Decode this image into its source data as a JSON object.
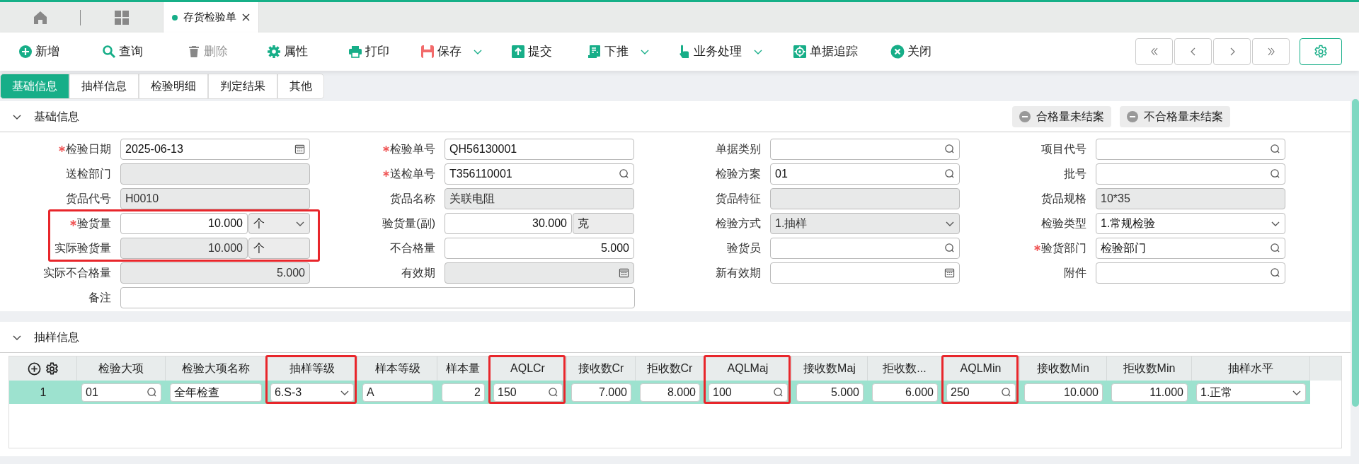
{
  "open_tabs": [
    {
      "label": "存货检验单",
      "selected": true
    }
  ],
  "toolbar": [
    {
      "label": "新增",
      "kind": "add",
      "disabled": false,
      "dropdown": false
    },
    {
      "label": "查询",
      "kind": "search",
      "disabled": false,
      "dropdown": false
    },
    {
      "label": "删除",
      "kind": "delete",
      "disabled": true,
      "dropdown": false
    },
    {
      "label": "属性",
      "kind": "settings",
      "disabled": false,
      "dropdown": false
    },
    {
      "label": "打印",
      "kind": "print",
      "disabled": false,
      "dropdown": false
    },
    {
      "label": "保存",
      "kind": "save",
      "disabled": false,
      "dropdown": true
    },
    {
      "label": "提交",
      "kind": "submit",
      "disabled": false,
      "dropdown": false
    },
    {
      "label": "下推",
      "kind": "push",
      "disabled": false,
      "dropdown": true
    },
    {
      "label": "业务处理",
      "kind": "hand",
      "disabled": false,
      "dropdown": true
    },
    {
      "label": "单据追踪",
      "kind": "track",
      "disabled": false,
      "dropdown": false
    },
    {
      "label": "关闭",
      "kind": "close",
      "disabled": false,
      "dropdown": false
    }
  ],
  "form_tabs": [
    {
      "label": "基础信息",
      "selected": true
    },
    {
      "label": "抽样信息",
      "selected": false
    },
    {
      "label": "检验明细",
      "selected": false
    },
    {
      "label": "判定结果",
      "selected": false
    },
    {
      "label": "其他",
      "selected": false
    }
  ],
  "basic_section": {
    "title": "基础信息",
    "expanded": true,
    "actions": [
      {
        "label": "合格量未结案"
      },
      {
        "label": "不合格量未结案"
      }
    ],
    "columns": [
      [
        {
          "label": "检验日期",
          "required": true,
          "kind": "date",
          "value": "2025-06-13",
          "disabled": false,
          "highlighted": false
        },
        {
          "label": "送检部门",
          "required": false,
          "kind": "text",
          "disabled": true,
          "highlighted": false
        },
        {
          "label": "货品代号",
          "required": false,
          "kind": "text",
          "value": "H0010",
          "disabled": true,
          "highlighted": false
        },
        {
          "label": "验货量",
          "required": true,
          "kind": "number",
          "value": "10.000",
          "disabled": false,
          "highlighted": true,
          "unit": {
            "text": "个",
            "kind": "select"
          }
        },
        {
          "label": "实际验货量",
          "required": false,
          "kind": "number",
          "value": "10.000",
          "disabled": true,
          "highlighted": true,
          "unit": {
            "text": "个",
            "kind": "text"
          }
        },
        {
          "label": "实际不合格量",
          "required": false,
          "kind": "number",
          "value": "5.000",
          "disabled": true,
          "highlighted": false
        }
      ],
      [
        {
          "label": "检验单号",
          "required": true,
          "kind": "text",
          "value": "QH56130001",
          "disabled": false,
          "highlighted": false
        },
        {
          "label": "送检单号",
          "required": true,
          "kind": "lookup",
          "value": "T356110001",
          "disabled": false,
          "highlighted": false
        },
        {
          "label": "货品名称",
          "required": false,
          "kind": "text",
          "value": "关联电阻",
          "disabled": true,
          "highlighted": false
        },
        {
          "label": "验货量(副)",
          "required": false,
          "kind": "number",
          "value": "30.000",
          "disabled": false,
          "highlighted": false,
          "unit": {
            "text": "克",
            "kind": "text"
          }
        },
        {
          "label": "不合格量",
          "required": false,
          "kind": "number",
          "value": "5.000",
          "disabled": false,
          "highlighted": false
        },
        {
          "label": "有效期",
          "required": false,
          "kind": "date",
          "disabled": true,
          "highlighted": false
        }
      ],
      [
        {
          "label": "单据类别",
          "required": false,
          "kind": "lookup",
          "disabled": false,
          "highlighted": false
        },
        {
          "label": "检验方案",
          "required": false,
          "kind": "lookup",
          "value": "01",
          "disabled": false,
          "highlighted": false
        },
        {
          "label": "货品特征",
          "required": false,
          "kind": "text",
          "disabled": true,
          "highlighted": false
        },
        {
          "label": "检验方式",
          "required": false,
          "kind": "select",
          "value": "1.抽样",
          "disabled": true,
          "highlighted": false
        },
        {
          "label": "验货员",
          "required": false,
          "kind": "lookup",
          "disabled": false,
          "highlighted": false
        },
        {
          "label": "新有效期",
          "required": false,
          "kind": "date",
          "disabled": false,
          "highlighted": false
        }
      ],
      [
        {
          "label": "项目代号",
          "required": false,
          "kind": "lookup",
          "disabled": false,
          "highlighted": false
        },
        {
          "label": "批号",
          "required": false,
          "kind": "lookup",
          "disabled": false,
          "highlighted": false
        },
        {
          "label": "货品规格",
          "required": false,
          "kind": "text",
          "value": "10*35",
          "disabled": true,
          "highlighted": false
        },
        {
          "label": "检验类型",
          "required": false,
          "kind": "select",
          "value": "1.常规检验",
          "disabled": false,
          "highlighted": false
        },
        {
          "label": "验货部门",
          "required": true,
          "kind": "lookup",
          "value": "检验部门",
          "disabled": false,
          "highlighted": false
        },
        {
          "label": "附件",
          "required": false,
          "kind": "lookup",
          "disabled": false,
          "highlighted": false
        }
      ]
    ],
    "remark": {
      "label": "备注",
      "required": false,
      "kind": "text",
      "disabled": false,
      "highlighted": false
    }
  },
  "sampling_section": {
    "title": "抽样信息",
    "expanded": true,
    "table": {
      "columns": [
        {
          "label": "检验大项",
          "highlighted": false
        },
        {
          "label": "检验大项名称",
          "highlighted": false
        },
        {
          "label": "抽样等级",
          "highlighted": true
        },
        {
          "label": "样本等级",
          "highlighted": false
        },
        {
          "label": "样本量",
          "highlighted": false
        },
        {
          "label": "AQLCr",
          "highlighted": true
        },
        {
          "label": "接收数Cr",
          "highlighted": false
        },
        {
          "label": "拒收数Cr",
          "highlighted": false
        },
        {
          "label": "AQLMaj",
          "highlighted": true
        },
        {
          "label": "接收数Maj",
          "highlighted": false
        },
        {
          "label": "拒收数...",
          "highlighted": false
        },
        {
          "label": "AQLMin",
          "highlighted": true
        },
        {
          "label": "接收数Min",
          "highlighted": false
        },
        {
          "label": "拒收数Min",
          "highlighted": false
        },
        {
          "label": "抽样水平",
          "highlighted": false
        }
      ],
      "rows": [
        {
          "number": "1",
          "selected": true,
          "cells": [
            {
              "value": "01",
              "kind": "lookup"
            },
            {
              "value": "全年检查",
              "kind": "text"
            },
            {
              "value": "6.S-3",
              "kind": "select"
            },
            {
              "value": "A",
              "kind": "text"
            },
            {
              "value": "2",
              "kind": "number"
            },
            {
              "value": "150",
              "kind": "lookup"
            },
            {
              "value": "7.000",
              "kind": "number"
            },
            {
              "value": "8.000",
              "kind": "number"
            },
            {
              "value": "100",
              "kind": "lookup"
            },
            {
              "value": "5.000",
              "kind": "number"
            },
            {
              "value": "6.000",
              "kind": "number"
            },
            {
              "value": "250",
              "kind": "lookup"
            },
            {
              "value": "10.000",
              "kind": "number"
            },
            {
              "value": "11.000",
              "kind": "number"
            },
            {
              "value": "1.正常",
              "kind": "select"
            }
          ]
        }
      ]
    }
  }
}
